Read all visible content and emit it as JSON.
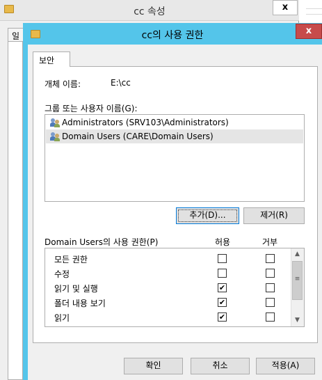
{
  "background_window": {
    "title": "cc 속성",
    "close_label": "x",
    "tab_label": "일"
  },
  "dialog": {
    "title": "cc의 사용 권한",
    "close_label": "x",
    "tab_label": "보안",
    "object_label": "개체 이름:",
    "object_value": "E:\\cc",
    "group_label": "그룹 또는 사용자 이름(G):",
    "principals": [
      {
        "name": "Administrators (SRV103\\Administrators)",
        "selected": false,
        "icon": "users-icon"
      },
      {
        "name": "Domain Users (CARE\\Domain Users)",
        "selected": true,
        "icon": "users-icon"
      }
    ],
    "add_button": "추가(D)...",
    "remove_button": "제거(R)",
    "permissions_label": "Domain Users의 사용 권한(P)",
    "allow_header": "허용",
    "deny_header": "거부",
    "permissions": [
      {
        "name": "모든 권한",
        "allow": false,
        "deny": false
      },
      {
        "name": "수정",
        "allow": false,
        "deny": false
      },
      {
        "name": "읽기 및 실행",
        "allow": true,
        "deny": false
      },
      {
        "name": "폴더 내용 보기",
        "allow": true,
        "deny": false
      },
      {
        "name": "읽기",
        "allow": true,
        "deny": false
      }
    ],
    "ok_button": "확인",
    "cancel_button": "취소",
    "apply_button": "적용(A)",
    "accent_color": "#54c5ea",
    "close_color": "#c74b4b"
  }
}
